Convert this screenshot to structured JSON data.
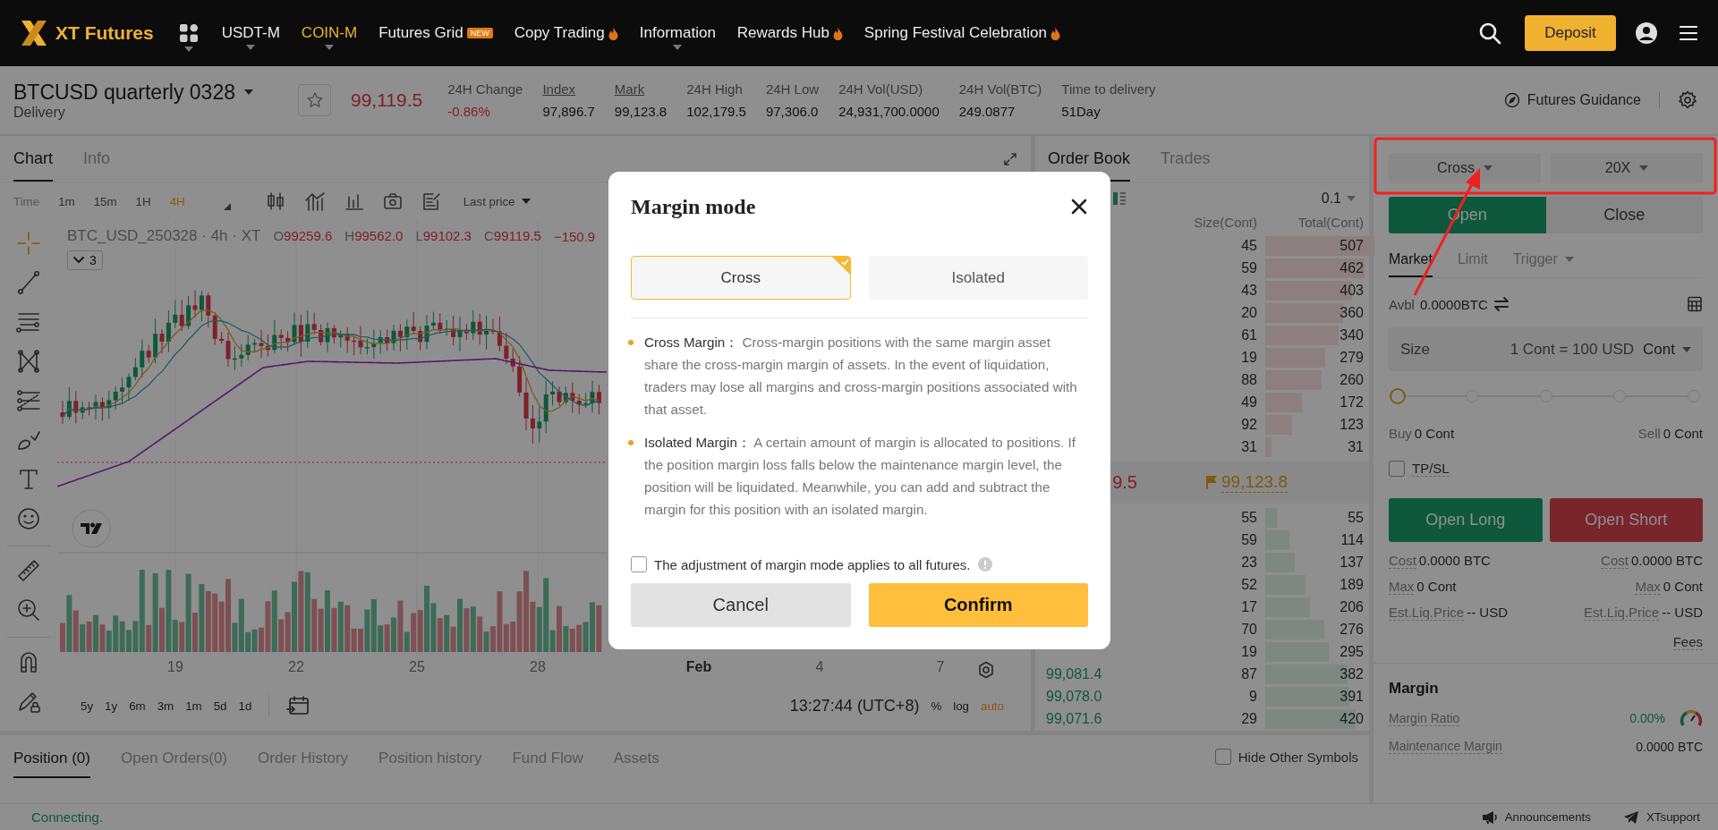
{
  "nav": {
    "brand": "XT Futures",
    "items": [
      {
        "label": "USDT-M",
        "selected": false,
        "caret": true,
        "hot": false
      },
      {
        "label": "COIN-M",
        "selected": true,
        "caret": true,
        "hot": false
      },
      {
        "label": "Futures Grid",
        "selected": false,
        "caret": false,
        "hot": false,
        "badge": "NEW"
      },
      {
        "label": "Copy Trading",
        "selected": false,
        "caret": false,
        "hot": true
      },
      {
        "label": "Information",
        "selected": false,
        "caret": true,
        "hot": false
      },
      {
        "label": "Rewards Hub",
        "selected": false,
        "caret": false,
        "hot": true
      },
      {
        "label": "Spring Festival Celebration",
        "selected": false,
        "caret": false,
        "hot": true
      }
    ],
    "deposit": "Deposit"
  },
  "ticker": {
    "symbol": "BTCUSD quarterly 0328",
    "type": "Delivery",
    "price": "99,119.5",
    "stats": [
      {
        "label": "24H Change",
        "value": "-0.86%",
        "kind": "change",
        "underlined": false
      },
      {
        "label": "Index",
        "value": "97,896.7",
        "kind": "plain",
        "underlined": true
      },
      {
        "label": "Mark",
        "value": "99,123.8",
        "kind": "plain",
        "underlined": true
      },
      {
        "label": "24H High",
        "value": "102,179.5",
        "kind": "plain",
        "underlined": false
      },
      {
        "label": "24H Low",
        "value": "97,306.0",
        "kind": "plain",
        "underlined": false
      },
      {
        "label": "24H Vol(USD)",
        "value": "24,931,700.0000",
        "kind": "plain",
        "underlined": false
      },
      {
        "label": "24H Vol(BTC)",
        "value": "249.0877",
        "kind": "plain",
        "underlined": false
      },
      {
        "label": "Time to delivery",
        "value": "51Day",
        "kind": "plain",
        "underlined": false
      }
    ],
    "guidance": "Futures Guidance"
  },
  "chart": {
    "tabs": [
      {
        "label": "Chart",
        "selected": true
      },
      {
        "label": "Info",
        "selected": false
      }
    ],
    "intervals": [
      {
        "label": "Time",
        "selected": false
      },
      {
        "label": "1m",
        "selected": false
      },
      {
        "label": "15m",
        "selected": false
      },
      {
        "label": "1H",
        "selected": false
      },
      {
        "label": "4H",
        "selected": true
      }
    ],
    "price_type": "Last price",
    "symbol_line": "BTC_USD_250328 · 4h · XT",
    "ohlc": [
      {
        "key": "O",
        "value": "99259.6"
      },
      {
        "key": "H",
        "value": "99562.0"
      },
      {
        "key": "L",
        "value": "99102.3"
      },
      {
        "key": "C",
        "value": "99119.5"
      }
    ],
    "change": "−150.9",
    "indicators_count": "3",
    "time_labels": [
      {
        "label": "19",
        "bold": false
      },
      {
        "label": "22",
        "bold": false
      },
      {
        "label": "25",
        "bold": false
      },
      {
        "label": "28",
        "bold": false
      },
      {
        "label": "Feb",
        "bold": true
      },
      {
        "label": "4",
        "bold": false
      },
      {
        "label": "7",
        "bold": false
      }
    ],
    "ranges": [
      "5y",
      "1y",
      "6m",
      "3m",
      "1m",
      "5d",
      "1d"
    ],
    "clock": "13:27:44 (UTC+8)",
    "scale_options": [
      {
        "label": "%",
        "on": false
      },
      {
        "label": "log",
        "on": false
      },
      {
        "label": "auto",
        "on": true
      }
    ]
  },
  "order_book": {
    "tabs": [
      {
        "label": "Order Book",
        "selected": true
      },
      {
        "label": "Trades",
        "selected": false
      }
    ],
    "precision": "0.1",
    "columns": {
      "size": "Size(Cont)",
      "total": "Total(Cont)"
    },
    "asks": [
      {
        "size": "45",
        "total": "507"
      },
      {
        "size": "59",
        "total": "462"
      },
      {
        "size": "43",
        "total": "403"
      },
      {
        "size": "20",
        "total": "360"
      },
      {
        "size": "61",
        "total": "340"
      },
      {
        "size": "19",
        "total": "279"
      },
      {
        "size": "88",
        "total": "260"
      },
      {
        "size": "49",
        "total": "172"
      },
      {
        "size": "92",
        "total": "123"
      },
      {
        "size": "31",
        "total": "31"
      }
    ],
    "last_price": "9.5",
    "mark_price": "99,123.8",
    "bids": [
      {
        "size": "55",
        "total": "55"
      },
      {
        "size": "59",
        "total": "114"
      },
      {
        "size": "23",
        "total": "137"
      },
      {
        "size": "52",
        "total": "189"
      },
      {
        "size": "17",
        "total": "206"
      },
      {
        "size": "70",
        "total": "276"
      },
      {
        "size": "19",
        "total": "295"
      },
      {
        "price": "99,081.4",
        "size": "87",
        "total": "382"
      },
      {
        "price": "99,078.0",
        "size": "9",
        "total": "391"
      },
      {
        "price": "99,071.6",
        "size": "29",
        "total": "420"
      }
    ]
  },
  "positions": {
    "tabs": [
      {
        "label": "Position (0)",
        "selected": true
      },
      {
        "label": "Open Orders(0)",
        "selected": false
      },
      {
        "label": "Order History",
        "selected": false
      },
      {
        "label": "Position history",
        "selected": false
      },
      {
        "label": "Fund Flow",
        "selected": false
      },
      {
        "label": "Assets",
        "selected": false
      }
    ],
    "hide_other": {
      "label": "Hide Other Symbols",
      "checked": false
    }
  },
  "order_form": {
    "margin_mode": "Cross",
    "leverage": "20X",
    "sides": [
      {
        "label": "Open",
        "selected": true
      },
      {
        "label": "Close",
        "selected": false
      }
    ],
    "order_types": [
      {
        "label": "Market",
        "selected": true,
        "caret": false
      },
      {
        "label": "Limit",
        "selected": false,
        "caret": false
      },
      {
        "label": "Trigger",
        "selected": false,
        "caret": true
      }
    ],
    "avbl_label": "Avbl",
    "avbl": "0.0000BTC",
    "size": {
      "label": "Size",
      "placeholder": "1 Cont = 100 USD",
      "unit": "Cont"
    },
    "slider": {
      "level": 0
    },
    "buy": {
      "label": "Buy",
      "value": "0 Cont"
    },
    "sell": {
      "label": "Sell",
      "value": "0 Cont"
    },
    "tpsl": {
      "label": "TP/SL",
      "checked": false
    },
    "buttons": [
      {
        "label": "Open Long",
        "kind": "long"
      },
      {
        "label": "Open Short",
        "kind": "short"
      }
    ],
    "details": [
      {
        "left": {
          "label": "Cost",
          "value": "0.0000 BTC"
        },
        "right": {
          "label": "Cost",
          "value": "0.0000 BTC"
        }
      },
      {
        "left": {
          "label": "Max",
          "value": "0 Cont"
        },
        "right": {
          "label": "Max",
          "value": "0 Cont"
        }
      },
      {
        "left": {
          "label": "Est.Liq.Price",
          "value": "-- USD"
        },
        "right": {
          "label": "Est.Liq.Price",
          "value": "-- USD"
        }
      }
    ],
    "fees": "Fees",
    "margin": {
      "title": "Margin",
      "rows": [
        {
          "label": "Margin Ratio",
          "value": "0.00%",
          "kind": "ratio"
        },
        {
          "label": "Maintenance Margin",
          "value": "0.0000 BTC",
          "kind": "plain"
        }
      ]
    }
  },
  "status": {
    "connection": "Connecting.",
    "links": [
      {
        "label": "Announcements",
        "kind": "announce"
      },
      {
        "label": "XTsupport",
        "kind": "support"
      }
    ]
  },
  "modal": {
    "title": "Margin mode",
    "options": [
      {
        "label": "Cross",
        "selected": true
      },
      {
        "label": "Isolated",
        "selected": false
      }
    ],
    "notes": [
      "**Cross Margin：** Cross-margin positions with the same margin asset share the cross-margin margin of assets. In the event of liquidation, traders may lose all margins and cross-margin positions associated with that asset.",
      "**Isolated Margin：** A certain amount of margin is allocated to positions. If the position margin loss falls below the maintenance margin level, the position will be liquidated. Meanwhile, you can add and subtract the margin for this position with an isolated margin."
    ],
    "apply_all": {
      "label": "The adjustment of margin mode applies to all futures.",
      "checked": false
    },
    "cancel": "Cancel",
    "confirm": "Confirm"
  }
}
